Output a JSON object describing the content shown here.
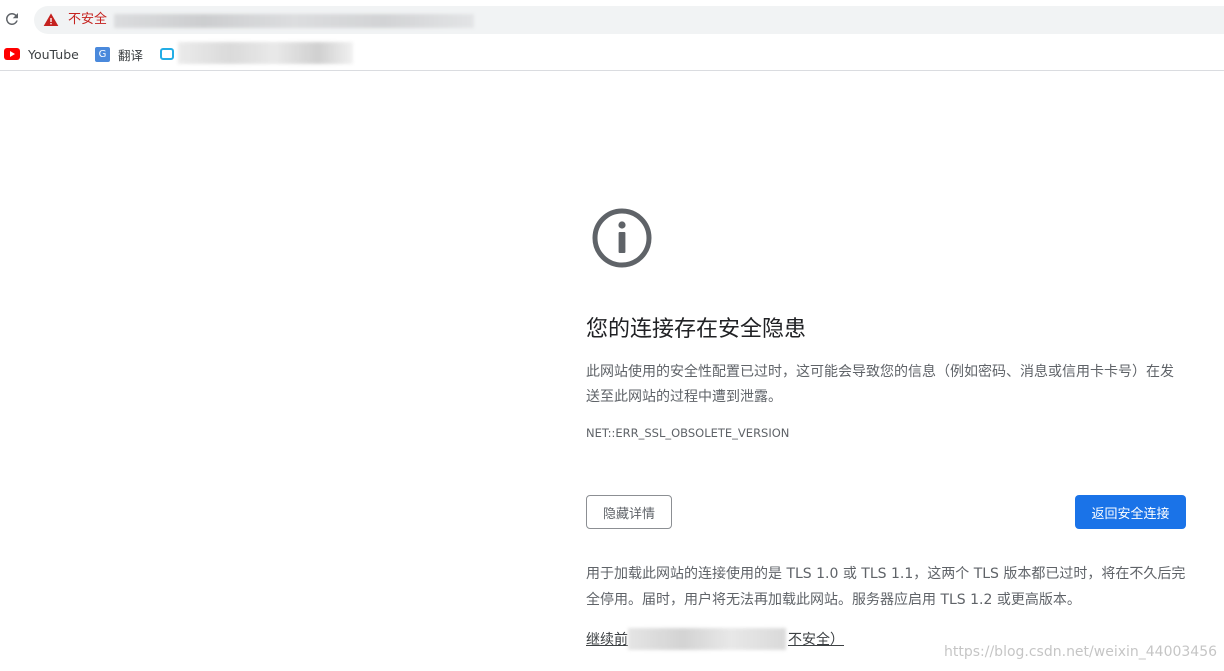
{
  "address_bar": {
    "security_label": "不安全"
  },
  "bookmarks": [
    {
      "label": "YouTube",
      "icon": "youtube-icon"
    },
    {
      "label": "翻译",
      "icon": "translate-icon"
    },
    {
      "label": "",
      "icon": "bilibili-icon"
    }
  ],
  "interstitial": {
    "icon": "info-icon",
    "heading": "您的连接存在安全隐患",
    "explanation": "此网站使用的安全性配置已过时，这可能会导致您的信息（例如密码、消息或信用卡卡号）在发送至此网站的过程中遭到泄露。",
    "error_code": "NET::ERR_SSL_OBSOLETE_VERSION",
    "details_button": "隐藏详情",
    "primary_button": "返回安全连接",
    "details_text": "用于加载此网站的连接使用的是 TLS 1.0 或 TLS 1.1，这两个 TLS 版本都已过时，将在不久后完全停用。届时，用户将无法再加载此网站。服务器应启用 TLS 1.2 或更高版本。",
    "proceed_link_start": "继续前",
    "proceed_link_end": "不安全）"
  },
  "watermark": "https://blog.csdn.net/weixin_44003456",
  "colors": {
    "not_secure_red": "#c5221f",
    "primary_blue": "#1a73e8",
    "icon_gray": "#5f6368"
  }
}
